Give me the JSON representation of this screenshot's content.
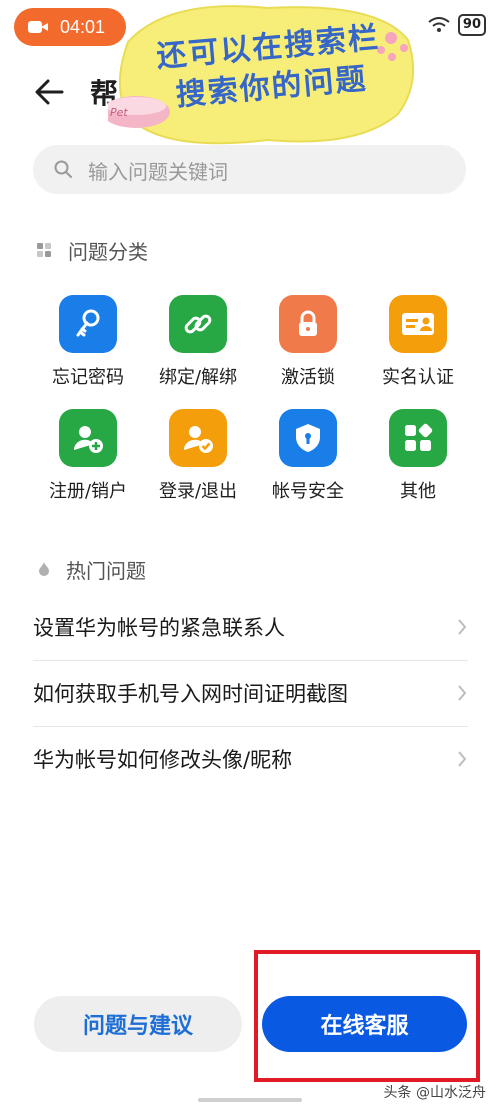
{
  "status_bar": {
    "time": "04:01",
    "battery": "90"
  },
  "header": {
    "title_fragment": "帮"
  },
  "sticker": {
    "line1": "还可以在搜索栏",
    "line2": "搜索你的问题",
    "bowl_text": "Pet"
  },
  "search": {
    "placeholder": "输入问题关键词"
  },
  "categories": {
    "title": "问题分类",
    "items": [
      {
        "label": "忘记密码",
        "icon": "key-icon",
        "color": "#1a7ee8"
      },
      {
        "label": "绑定/解绑",
        "icon": "link-icon",
        "color": "#28a745"
      },
      {
        "label": "激活锁",
        "icon": "lock-icon",
        "color": "#f07a4a"
      },
      {
        "label": "实名认证",
        "icon": "id-card-icon",
        "color": "#f59e0b"
      },
      {
        "label": "注册/销户",
        "icon": "add-user-icon",
        "color": "#28a745"
      },
      {
        "label": "登录/退出",
        "icon": "user-check-icon",
        "color": "#f59e0b"
      },
      {
        "label": "帐号安全",
        "icon": "shield-icon",
        "color": "#1a7ee8"
      },
      {
        "label": "其他",
        "icon": "grid-icon",
        "color": "#28a745"
      }
    ]
  },
  "hot": {
    "title": "热门问题",
    "items": [
      "设置华为帐号的紧急联系人",
      "如何获取手机号入网时间证明截图",
      "华为帐号如何修改头像/昵称"
    ]
  },
  "buttons": {
    "feedback": "问题与建议",
    "service": "在线客服"
  },
  "watermark": "头条 @山水泛舟"
}
